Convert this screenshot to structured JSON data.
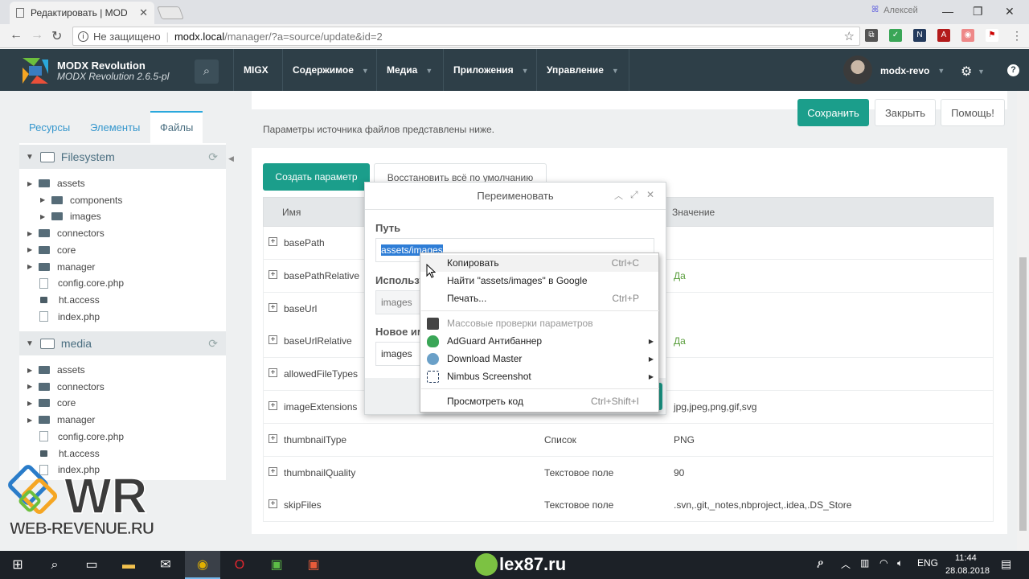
{
  "browser": {
    "tab_title": "Редактировать | MODX R",
    "profile_name": "Алексей",
    "security_label": "Не защищено",
    "url_host": "modx.local",
    "url_path": "/manager/?a=source/update&id=2"
  },
  "header": {
    "brand_name": "MODX Revolution",
    "brand_version": "MODX Revolution 2.6.5-pl",
    "nav": [
      {
        "label": "MIGX"
      },
      {
        "label": "Содержимое"
      },
      {
        "label": "Медиа"
      },
      {
        "label": "Приложения"
      },
      {
        "label": "Управление"
      }
    ],
    "username": "modx-revo"
  },
  "left_tabs": [
    {
      "label": "Ресурсы"
    },
    {
      "label": "Элементы"
    },
    {
      "label": "Файлы",
      "active": true
    }
  ],
  "filesystem": {
    "title": "Filesystem",
    "items": [
      {
        "label": "assets",
        "type": "folder",
        "level": 0
      },
      {
        "label": "components",
        "type": "folder",
        "level": 1
      },
      {
        "label": "images",
        "type": "folder",
        "level": 1
      },
      {
        "label": "connectors",
        "type": "folder",
        "level": 0
      },
      {
        "label": "core",
        "type": "folder",
        "level": 0
      },
      {
        "label": "manager",
        "type": "folder",
        "level": 0
      },
      {
        "label": "config.core.php",
        "type": "file",
        "level": 0
      },
      {
        "label": "ht.access",
        "type": "lock",
        "level": 0
      },
      {
        "label": "index.php",
        "type": "file",
        "level": 0
      }
    ]
  },
  "media": {
    "title": "media",
    "items": [
      {
        "label": "assets",
        "type": "folder"
      },
      {
        "label": "connectors",
        "type": "folder"
      },
      {
        "label": "core",
        "type": "folder"
      },
      {
        "label": "manager",
        "type": "folder"
      },
      {
        "label": "config.core.php",
        "type": "file"
      },
      {
        "label": "ht.access",
        "type": "lock"
      },
      {
        "label": "index.php",
        "type": "file"
      }
    ]
  },
  "actions": {
    "save": "Сохранить",
    "close": "Закрыть",
    "help": "Помощь!"
  },
  "info_text": "Параметры источника файлов представлены ниже.",
  "grid": {
    "create_btn": "Создать параметр",
    "restore_btn": "Восстановить всё по умолчанию",
    "col_name": "Имя",
    "col_value": "Значение",
    "rows": [
      {
        "name": "basePath",
        "type": "",
        "value": ""
      },
      {
        "name": "basePathRelative",
        "type": "",
        "value": "Да"
      },
      {
        "name": "baseUrl",
        "type": "",
        "value": ""
      },
      {
        "name": "baseUrlRelative",
        "type": "",
        "value": "Да"
      },
      {
        "name": "allowedFileTypes",
        "type": "",
        "value": ""
      },
      {
        "name": "imageExtensions",
        "type": "",
        "value": "jpg,jpeg,png,gif,svg"
      },
      {
        "name": "thumbnailType",
        "type": "Список",
        "value": "PNG"
      },
      {
        "name": "thumbnailQuality",
        "type": "Текстовое поле",
        "value": "90"
      },
      {
        "name": "skipFiles",
        "type": "Текстовое поле",
        "value": ".svn,.git,_notes,nbproject,.idea,.DS_Store"
      }
    ]
  },
  "dialog": {
    "title": "Переименовать",
    "path_label": "Путь",
    "path_value": "assets/images",
    "used_label": "Использу",
    "used_value": "images",
    "new_label": "Новое им",
    "new_value": "images"
  },
  "context_menu": {
    "items": [
      {
        "label": "Копировать",
        "shortcut": "Ctrl+C"
      },
      {
        "label": "Найти \"assets/images\" в Google",
        "shortcut": ""
      },
      {
        "label": "Печать...",
        "shortcut": "Ctrl+P"
      },
      {
        "label": "Массовые проверки параметров",
        "shortcut": "",
        "disabled": true
      },
      {
        "label": "AdGuard Антибаннер",
        "shortcut": ""
      },
      {
        "label": "Download Master",
        "shortcut": ""
      },
      {
        "label": "Nimbus Screenshot",
        "shortcut": ""
      },
      {
        "label": "Просмотреть код",
        "shortcut": "Ctrl+Shift+I"
      }
    ]
  },
  "watermark": {
    "logo_text": "WR",
    "site_text": "WEB-REVENUE.RU"
  },
  "taskbar": {
    "center_brand": "lex87.ru",
    "lang": "ENG",
    "time": "11:44",
    "date": "28.08.2018"
  },
  "colors": {
    "header_bg": "#2e3f48",
    "accent": "#1b9e8b",
    "link": "#3697cd",
    "yes_value": "#5a9e3d"
  }
}
